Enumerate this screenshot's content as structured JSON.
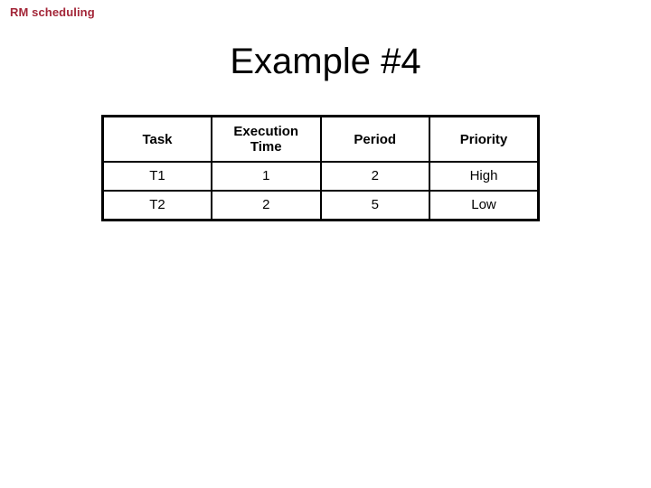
{
  "slide": {
    "header_label": "RM scheduling",
    "title": "Example #4",
    "header_color": "#A32638",
    "background_color": "#FFFFFF",
    "text_color": "#000000"
  },
  "table": {
    "border_color": "#000000",
    "headers": {
      "task": "Task",
      "execution_time_line1": "Execution",
      "execution_time_line2": "Time",
      "period": "Period",
      "priority": "Priority"
    },
    "rows": [
      {
        "task": "T1",
        "execution_time": "1",
        "period": "2",
        "priority": "High"
      },
      {
        "task": "T2",
        "execution_time": "2",
        "period": "5",
        "priority": "Low"
      }
    ]
  }
}
